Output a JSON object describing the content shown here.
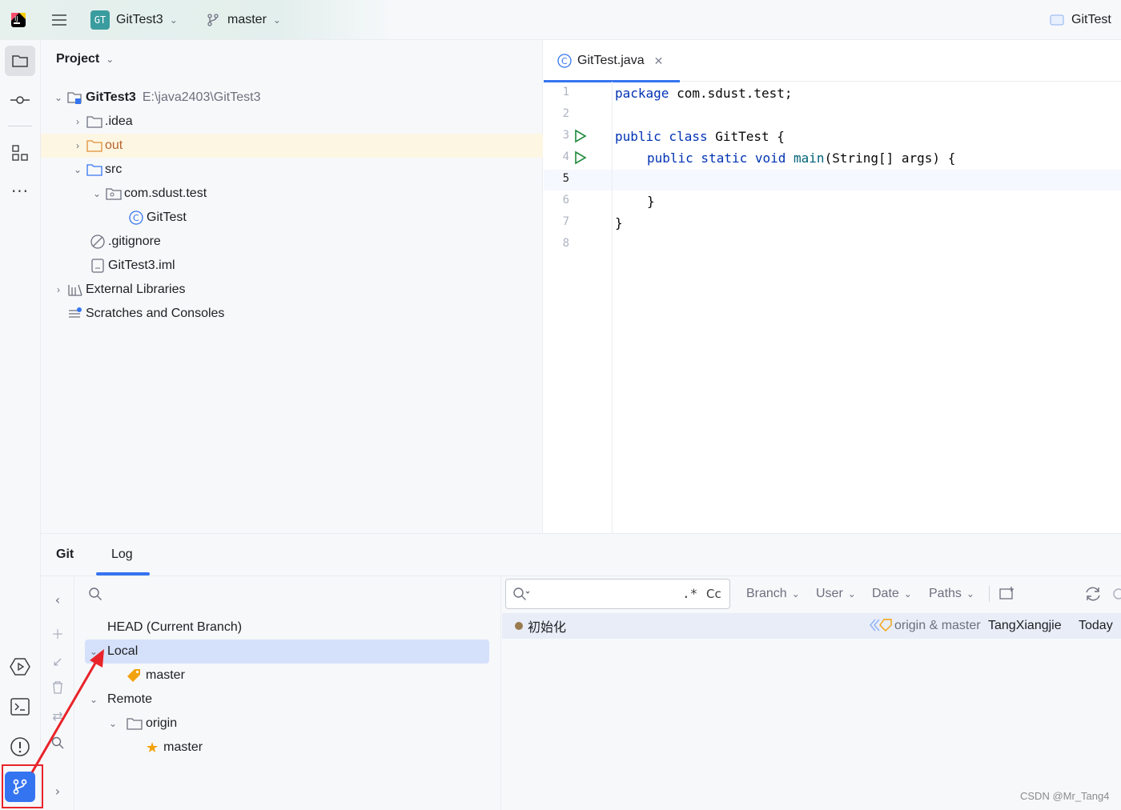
{
  "topbar": {
    "project_badge": "GT",
    "project_name": "GitTest3",
    "branch": "master",
    "run_config": "GitTest"
  },
  "project_panel": {
    "title": "Project",
    "root_name": "GitTest3",
    "root_path": "E:\\java2403\\GitTest3",
    "items": [
      {
        "label": ".idea"
      },
      {
        "label": "out"
      },
      {
        "label": "src"
      },
      {
        "label": "com.sdust.test"
      },
      {
        "label": "GitTest"
      },
      {
        "label": ".gitignore"
      },
      {
        "label": "GitTest3.iml"
      },
      {
        "label": "External Libraries"
      },
      {
        "label": "Scratches and Consoles"
      }
    ]
  },
  "editor": {
    "tab_label": "GitTest.java",
    "line_numbers": [
      "1",
      "2",
      "3",
      "4",
      "5",
      "6",
      "7",
      "8"
    ],
    "code": {
      "l1_kw": "package",
      "l1_rest": " com.sdust.test;",
      "l3_kw": "public class",
      "l3_rest": " GitTest {",
      "l4_kw": "public static void",
      "l4_fn": " main",
      "l4_rest": "(String[] args) {",
      "l6": "}",
      "l7": "}"
    }
  },
  "bottom": {
    "tab_git": "Git",
    "tab_log": "Log",
    "branches": {
      "head": "HEAD (Current Branch)",
      "local": "Local",
      "local_master": "master",
      "remote": "Remote",
      "origin": "origin",
      "remote_master": "master"
    },
    "log": {
      "filter_regex": ".*",
      "filter_case": "Cc",
      "filters": [
        "Branch",
        "User",
        "Date",
        "Paths"
      ],
      "commit": {
        "message": "初始化",
        "refs": "origin & master",
        "author": "TangXiangjie",
        "date": "Today"
      }
    }
  },
  "watermark": "CSDN @Mr_Tang4",
  "colors": {
    "accent": "#3574f0",
    "annotation_red": "#e8242a",
    "keyword": "#0033b3",
    "highlight_row": "#fdf6e3"
  }
}
